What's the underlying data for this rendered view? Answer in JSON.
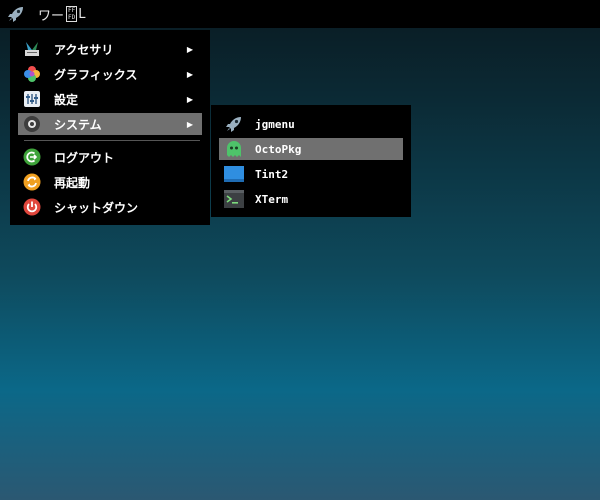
{
  "taskbar": {
    "workspace_prefix": "ワー",
    "box_top": "FF",
    "box_bottom": "FD",
    "workspace_suffix": "L"
  },
  "main_menu": {
    "items": [
      {
        "label": "アクセサリ",
        "icon": "accessories-icon",
        "submenu": true
      },
      {
        "label": "グラフィックス",
        "icon": "graphics-icon",
        "submenu": true
      },
      {
        "label": "設定",
        "icon": "settings-icon",
        "submenu": true
      },
      {
        "label": "システム",
        "icon": "system-icon",
        "submenu": true,
        "selected": true
      }
    ],
    "actions": [
      {
        "label": "ログアウト",
        "icon": "logout-icon"
      },
      {
        "label": "再起動",
        "icon": "reboot-icon"
      },
      {
        "label": "シャットダウン",
        "icon": "shutdown-icon"
      }
    ],
    "arrow": "▶"
  },
  "system_submenu": {
    "items": [
      {
        "label": "jgmenu",
        "icon": "rocket-icon"
      },
      {
        "label": "OctoPkg",
        "icon": "octopkg-icon",
        "selected": true
      },
      {
        "label": "Tint2",
        "icon": "tint2-icon"
      },
      {
        "label": "XTerm",
        "icon": "terminal-icon"
      }
    ]
  },
  "colors": {
    "selection": "#707070",
    "menu_background": "#000000",
    "logout": "#3ea33a",
    "reboot": "#f0a020",
    "shutdown": "#e0463c",
    "octopkg": "#4ec36a",
    "tint2": "#2f8ee0"
  }
}
